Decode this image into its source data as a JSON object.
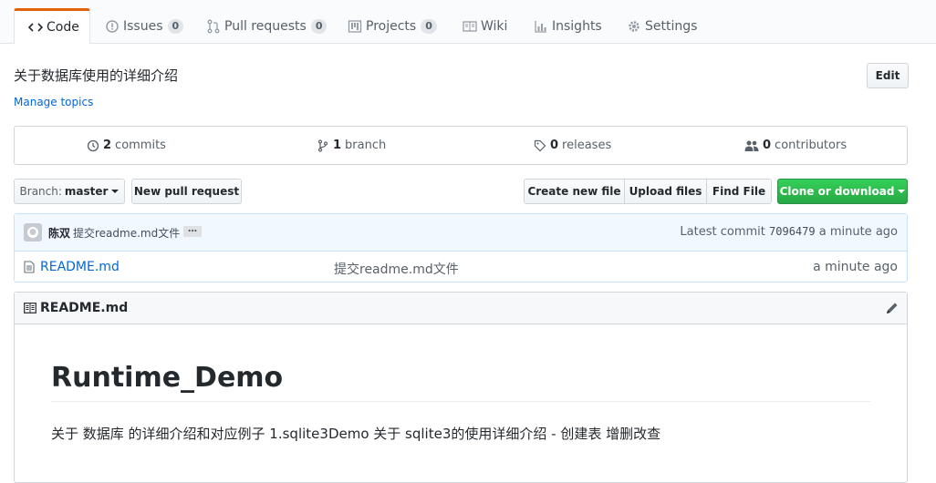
{
  "tabs": [
    {
      "label": "Code",
      "icon": "code-icon",
      "selected": true
    },
    {
      "label": "Issues",
      "icon": "issue-icon",
      "count": "0"
    },
    {
      "label": "Pull requests",
      "icon": "pull-request-icon",
      "count": "0"
    },
    {
      "label": "Projects",
      "icon": "project-icon",
      "count": "0"
    },
    {
      "label": "Wiki",
      "icon": "book-icon"
    },
    {
      "label": "Insights",
      "icon": "graph-icon"
    },
    {
      "label": "Settings",
      "icon": "gear-icon"
    }
  ],
  "repo": {
    "description": "关于数据库使用的详细介绍",
    "manage_topics": "Manage topics",
    "edit_label": "Edit"
  },
  "summary": {
    "commits_num": "2",
    "commits_label": "commits",
    "branch_num": "1",
    "branch_label": "branch",
    "releases_num": "0",
    "releases_label": "releases",
    "contributors_num": "0",
    "contributors_label": "contributors"
  },
  "toolbar": {
    "branch_prefix": "Branch:",
    "branch_name": "master",
    "new_pr": "New pull request",
    "create_file": "Create new file",
    "upload_files": "Upload files",
    "find_file": "Find File",
    "clone": "Clone or download"
  },
  "commit": {
    "author": "陈双",
    "message": "提交readme.md文件",
    "ellipsis": "…",
    "latest_label": "Latest commit",
    "sha": "7096479",
    "age": "a minute ago"
  },
  "files": [
    {
      "name": "README.md",
      "message": "提交readme.md文件",
      "age": "a minute ago"
    }
  ],
  "readme": {
    "header": "README.md",
    "h1": "Runtime_Demo",
    "paragraph": "关于 数据库 的详细介绍和对应例子 1.sqlite3Demo 关于 sqlite3的使用详细介绍 - 创建表 增删改查"
  },
  "colors": {
    "accent_tab": "#e36209",
    "link": "#0366d6",
    "clone_green": "#28a745",
    "commit_bar_bg": "#f1f8ff"
  }
}
